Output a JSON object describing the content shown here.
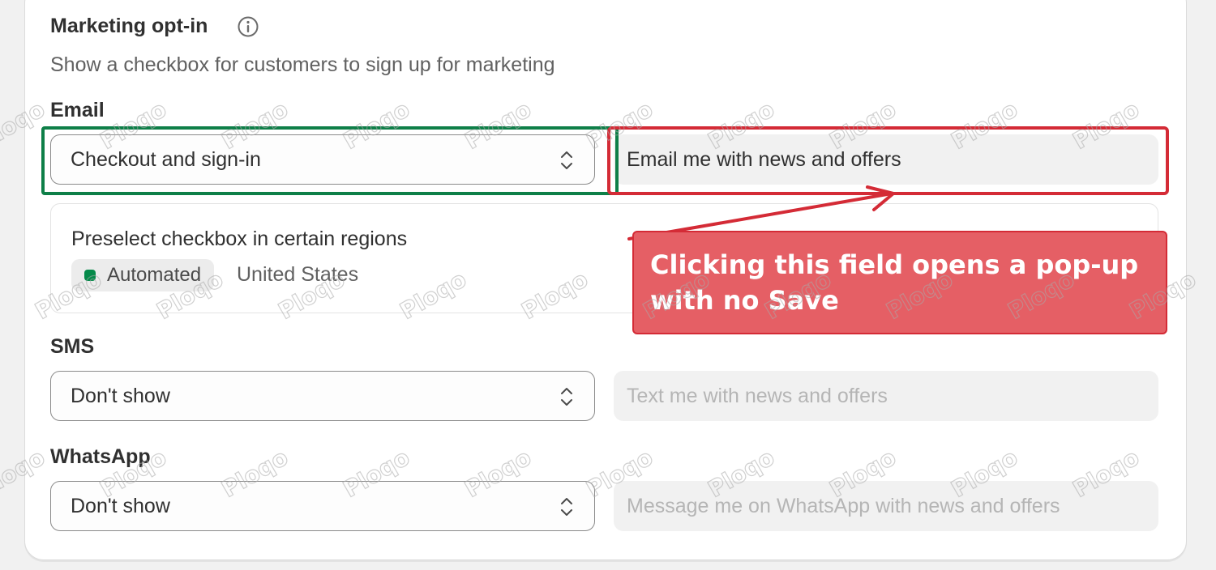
{
  "header": {
    "title": "Marketing opt-in",
    "subtitle": "Show a checkbox for customers to sign up for marketing"
  },
  "email": {
    "label": "Email",
    "select_value": "Checkout and sign-in",
    "field_value": "Email me with news and offers",
    "region_title": "Preselect checkbox in certain regions",
    "badge_label": "Automated",
    "region_value": "United States"
  },
  "sms": {
    "label": "SMS",
    "select_value": "Don't show",
    "field_placeholder": "Text me with news and offers"
  },
  "whatsapp": {
    "label": "WhatsApp",
    "select_value": "Don't show",
    "field_placeholder": "Message me on WhatsApp with news and offers"
  },
  "annotation": {
    "callout_text": "Clicking this field opens a pop-up with no Save"
  },
  "watermark": "Ploqo",
  "colors": {
    "highlight_green": "#0e7f48",
    "highlight_red": "#d42b36",
    "callout_fill": "#e55f65",
    "badge_dot": "#058a4a"
  },
  "icons": [
    "info-icon",
    "chevron-up-down-icon",
    "status-dot-icon"
  ]
}
